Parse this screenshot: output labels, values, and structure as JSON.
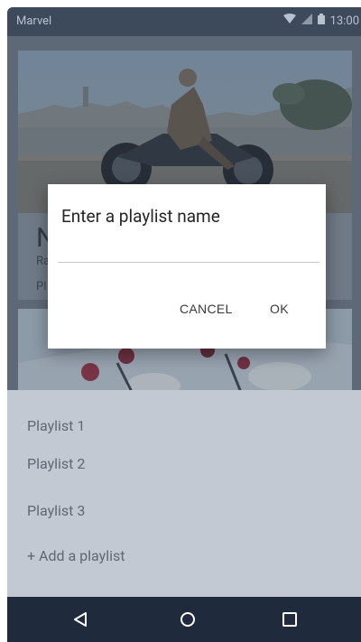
{
  "status_bar": {
    "app_name": "Marvel",
    "time": "13:00"
  },
  "background_card": {
    "title_initial": "N",
    "subtitle_initial": "Ra",
    "meta_initial": "Pl"
  },
  "playlist_sheet": {
    "items": [
      "Playlist 1",
      "Playlist 2",
      "Playlist 3"
    ],
    "add_label": "+ Add a playlist"
  },
  "dialog": {
    "title": "Enter a playlist name",
    "input_value": "",
    "cancel_label": "CANCEL",
    "ok_label": "OK"
  },
  "colors": {
    "status_bar": "#3d4a5c",
    "nav_bar": "#1f2b3d",
    "sheet": "#c3c9d2"
  },
  "icons": [
    "wifi-icon",
    "signal-icon",
    "battery-icon",
    "back-icon",
    "home-icon",
    "recents-icon"
  ]
}
